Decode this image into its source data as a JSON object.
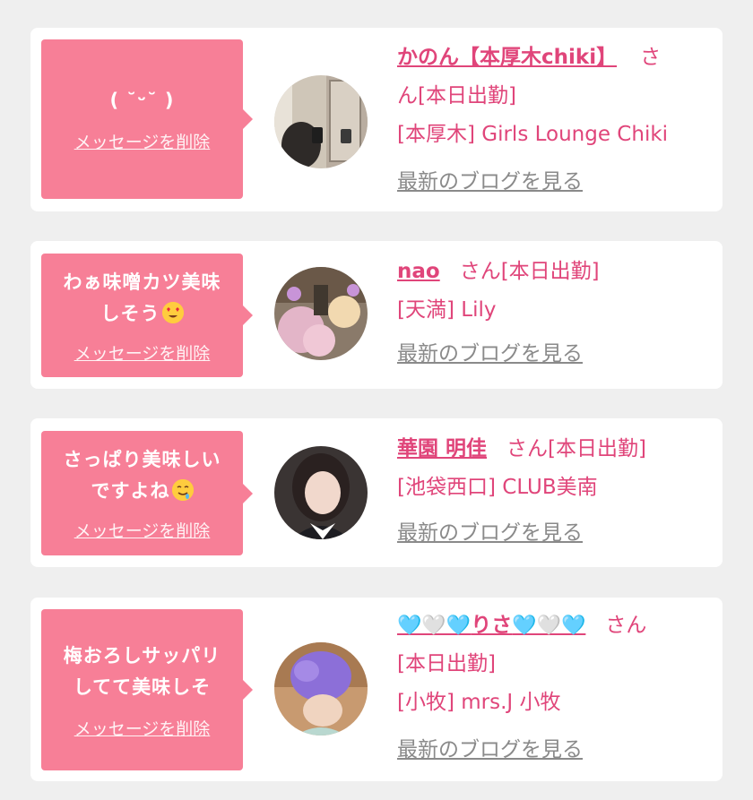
{
  "messages": [
    {
      "text_lines": [
        "( ˘ᵕ˘ )"
      ],
      "delete_label": "メッセージを削除",
      "name": "かのん【本厚木chiki】",
      "suffix": "さ",
      "line2": "ん[本日出勤]",
      "shop": "[本厚木] Girls Lounge Chiki",
      "blog_label": "最新のブログを見る",
      "avatar_icon": "mirror-selfie-photo"
    },
    {
      "text_lines": [
        "わぁ味噌カツ美味",
        "しそう"
      ],
      "emoji": "heart-eyes-emoji",
      "delete_label": "メッセージを削除",
      "name": "nao",
      "suffix": "さん[本日出勤]",
      "shop": "[天満] Lily",
      "blog_label": "最新のブログを見る",
      "avatar_icon": "flowers-photo"
    },
    {
      "text_lines": [
        "さっぱり美味しい",
        "ですよね"
      ],
      "emoji": "drooling-face-emoji",
      "delete_label": "メッセージを削除",
      "name": "華園 明佳",
      "suffix": "さん[本日出勤]",
      "shop": "[池袋西口] CLUB美南",
      "blog_label": "最新のブログを見る",
      "avatar_icon": "portrait-photo"
    },
    {
      "text_lines": [
        "梅おろしサッパリ",
        "してて美味しそ"
      ],
      "delete_label": "メッセージを削除",
      "name": "りさ",
      "name_prefix_hearts": "🩵🤍🩵",
      "name_suffix_hearts": "🩵🤍🩵",
      "suffix": "さん",
      "line2": "[本日出勤]",
      "shop": "[小牧] mrs.J 小牧",
      "blog_label": "最新のブログを見る",
      "avatar_icon": "purple-blur-portrait-photo"
    }
  ],
  "colors": {
    "bubble": "#f77f97",
    "accent_text": "#e0457a",
    "link_gray": "#8a8a8a",
    "background": "#efefef"
  }
}
